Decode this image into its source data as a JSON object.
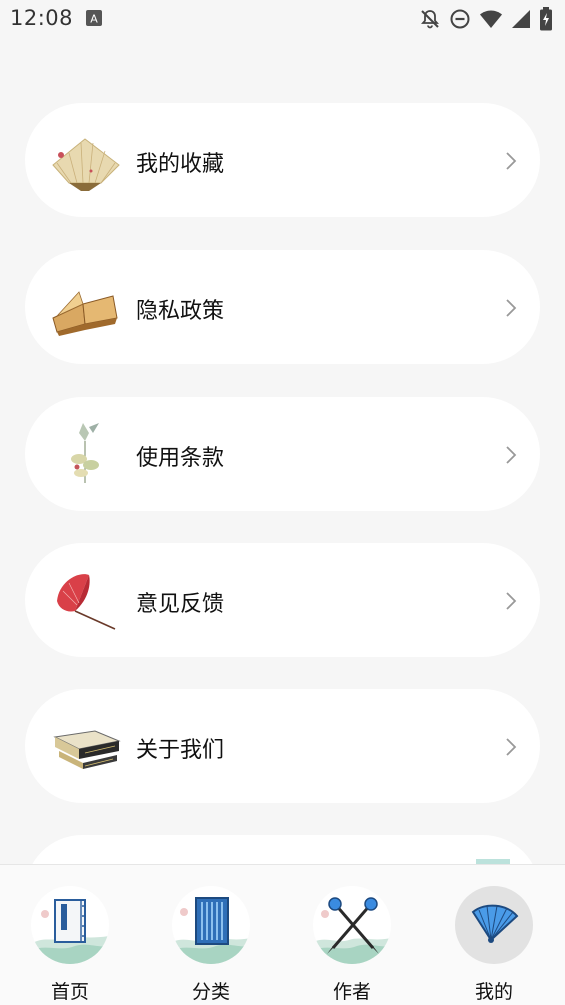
{
  "status_bar": {
    "time": "12:08",
    "icons": [
      "notification-icon",
      "bell-off-icon",
      "do-not-disturb-icon",
      "wifi-icon",
      "signal-icon",
      "battery-charging-icon"
    ]
  },
  "menu": {
    "items": [
      {
        "label": "我的收藏",
        "icon": "folding-fan-icon"
      },
      {
        "label": "隐私政策",
        "icon": "open-book-icon"
      },
      {
        "label": "使用条款",
        "icon": "hummingbird-flower-icon"
      },
      {
        "label": "意见反馈",
        "icon": "red-umbrella-icon"
      },
      {
        "label": "关于我们",
        "icon": "scroll-case-icon"
      }
    ]
  },
  "tabbar": {
    "tabs": [
      {
        "label": "首页",
        "icon": "book-icon",
        "active": false
      },
      {
        "label": "分类",
        "icon": "category-book-icon",
        "active": false
      },
      {
        "label": "作者",
        "icon": "crossed-brushes-icon",
        "active": false
      },
      {
        "label": "我的",
        "icon": "blue-fan-icon",
        "active": true
      }
    ]
  },
  "colors": {
    "background": "#f6f6f6",
    "card": "#ffffff",
    "active_tab": "#e2e2e2",
    "accent_blue": "#3a8be0"
  }
}
